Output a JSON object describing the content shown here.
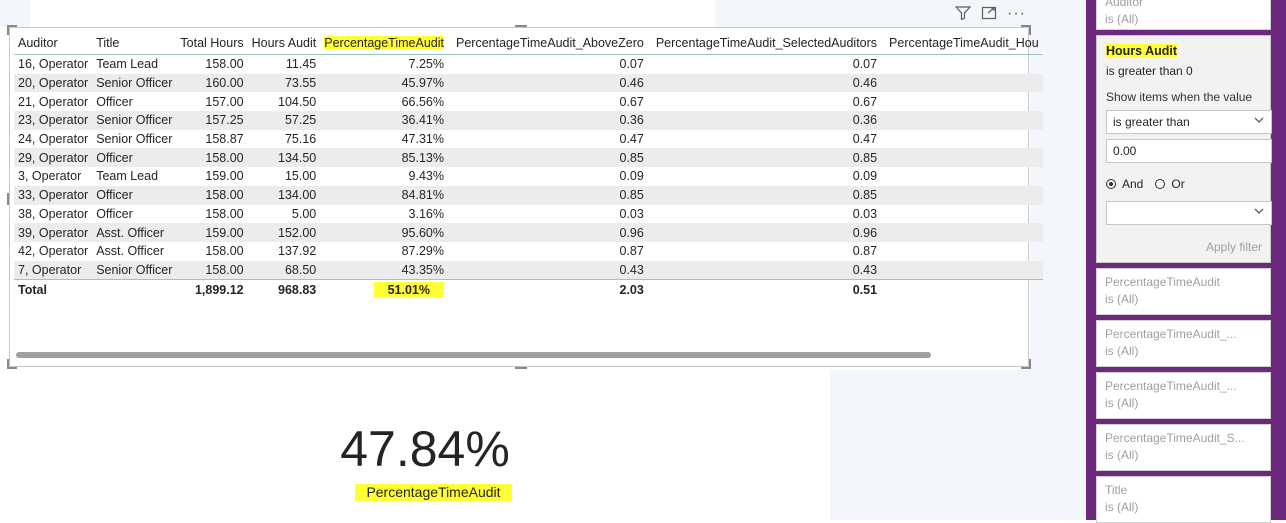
{
  "toolbar": {
    "filter_icon": "filter-icon",
    "focus_icon": "focus-mode-icon",
    "more_icon": "more-options-icon"
  },
  "table": {
    "headers": [
      "Auditor",
      "Title",
      "Total Hours",
      "Hours Audit",
      "PercentageTimeAudit",
      "PercentageTimeAudit_AboveZero",
      "PercentageTimeAudit_SelectedAuditors",
      "PercentageTimeAudit_Hou"
    ],
    "rows": [
      [
        "16, Operator",
        "Team Lead",
        "158.00",
        "11.45",
        "7.25%",
        "0.07",
        "0.07"
      ],
      [
        "20, Operator",
        "Senior Officer",
        "160.00",
        "73.55",
        "45.97%",
        "0.46",
        "0.46"
      ],
      [
        "21, Operator",
        "Officer",
        "157.00",
        "104.50",
        "66.56%",
        "0.67",
        "0.67"
      ],
      [
        "23, Operator",
        "Senior Officer",
        "157.25",
        "57.25",
        "36.41%",
        "0.36",
        "0.36"
      ],
      [
        "24, Operator",
        "Senior Officer",
        "158.87",
        "75.16",
        "47.31%",
        "0.47",
        "0.47"
      ],
      [
        "29, Operator",
        "Officer",
        "158.00",
        "134.50",
        "85.13%",
        "0.85",
        "0.85"
      ],
      [
        "3, Operator",
        "Team Lead",
        "159.00",
        "15.00",
        "9.43%",
        "0.09",
        "0.09"
      ],
      [
        "33, Operator",
        "Officer",
        "158.00",
        "134.00",
        "84.81%",
        "0.85",
        "0.85"
      ],
      [
        "38, Operator",
        "Officer",
        "158.00",
        "5.00",
        "3.16%",
        "0.03",
        "0.03"
      ],
      [
        "39, Operator",
        "Asst. Officer",
        "159.00",
        "152.00",
        "95.60%",
        "0.96",
        "0.96"
      ],
      [
        "42, Operator",
        "Asst. Officer",
        "158.00",
        "137.92",
        "87.29%",
        "0.87",
        "0.87"
      ],
      [
        "7, Operator",
        "Senior Officer",
        "158.00",
        "68.50",
        "43.35%",
        "0.43",
        "0.43"
      ]
    ],
    "total": [
      "Total",
      "",
      "1,899.12",
      "968.83",
      "51.01%",
      "2.03",
      "0.51"
    ]
  },
  "card": {
    "value": "47.84%",
    "label": "PercentageTimeAudit"
  },
  "filter_pane": {
    "top_card": {
      "title": "Auditor",
      "state": "is (All)"
    },
    "expanded": {
      "title": "Hours Audit",
      "subtitle": "is greater than 0",
      "show_items": "Show items when the value",
      "condition": "is greater than",
      "value": "0.00",
      "and": "And",
      "or": "Or",
      "apply": "Apply filter"
    },
    "cards": [
      {
        "title": "PercentageTimeAudit",
        "state": "is (All)"
      },
      {
        "title": "PercentageTimeAudit_...",
        "state": "is (All)"
      },
      {
        "title": "PercentageTimeAudit_...",
        "state": "is (All)"
      },
      {
        "title": "PercentageTimeAudit_S...",
        "state": "is (All)"
      },
      {
        "title": "Title",
        "state": "is (All)"
      }
    ]
  }
}
